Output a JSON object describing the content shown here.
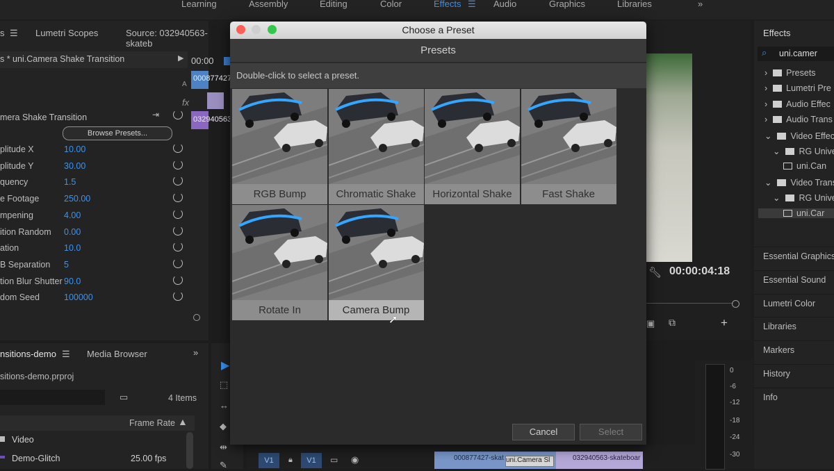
{
  "workspaces": [
    {
      "label": "Learning",
      "active": false
    },
    {
      "label": "Assembly",
      "active": false
    },
    {
      "label": "Editing",
      "active": false
    },
    {
      "label": "Color",
      "active": false
    },
    {
      "label": "Effects",
      "active": true
    },
    {
      "label": "Audio",
      "active": false
    },
    {
      "label": "Graphics",
      "active": false
    },
    {
      "label": "Libraries",
      "active": false
    }
  ],
  "left_panel": {
    "tab_fragment": "s",
    "tab_lumetri": "Lumetri Scopes",
    "tab_source": "Source: 032940563-skateb",
    "clip_title": "s * uni.Camera Shake Transition",
    "timecode": "00:00",
    "clip_a": "000877427",
    "clip_b": "032940563",
    "track_a": "A",
    "effect_name": "mera Shake Transition",
    "browse_presets": "Browse Presets...",
    "fx": "fx",
    "params": [
      {
        "label": "plitude X",
        "value": "10.00"
      },
      {
        "label": "plitude Y",
        "value": "30.00"
      },
      {
        "label": "quency",
        "value": "1.5"
      },
      {
        "label": "e Footage",
        "value": "250.00"
      },
      {
        "label": "mpening",
        "value": "4.00"
      },
      {
        "label": "ition Random",
        "value": "0.00"
      },
      {
        "label": "ation",
        "value": "10.0"
      },
      {
        "label": "B Separation",
        "value": "5"
      },
      {
        "label": "tion Blur Shutter",
        "value": "90.0"
      },
      {
        "label": "dom Seed",
        "value": "100000"
      }
    ]
  },
  "project_panel": {
    "tab": "nsitions-demo",
    "tab_media": "Media Browser",
    "file": "sitions-demo.prproj",
    "items": "4 Items",
    "col_frame_rate": "Frame Rate",
    "rows": [
      {
        "name": "Video",
        "rate": ""
      },
      {
        "name": "Demo-Glitch",
        "rate": "25.00 fps"
      }
    ]
  },
  "timeline": {
    "v1a": "V1",
    "v1b": "V1",
    "clip1": "000877427-skat",
    "clip2": "uni.Camera Sl",
    "clip3": "032940563-skateboar",
    "meter_ticks": [
      "0",
      "-6",
      "-12",
      "-18",
      "-24",
      "-30"
    ]
  },
  "program": {
    "timecode": "00:00:04:18"
  },
  "effects_panel": {
    "title": "Effects",
    "search": "uni.camer",
    "tree": [
      {
        "label": "Presets",
        "indent": 0
      },
      {
        "label": "Lumetri Pre",
        "indent": 0
      },
      {
        "label": "Audio Effec",
        "indent": 0
      },
      {
        "label": "Audio Trans",
        "indent": 0
      },
      {
        "label": "Video Effec",
        "indent": 0
      },
      {
        "label": "RG Unive",
        "indent": 1
      },
      {
        "label": "uni.Can",
        "indent": 2
      },
      {
        "label": "Video Trans",
        "indent": 0
      },
      {
        "label": "RG Unive",
        "indent": 1
      },
      {
        "label": "uni.Car",
        "indent": 2
      }
    ],
    "menu": [
      "Essential Graphics",
      "Essential Sound",
      "Lumetri Color",
      "Libraries",
      "Markers",
      "History",
      "Info"
    ]
  },
  "dialog": {
    "title": "Choose a Preset",
    "header": "Presets",
    "hint": "Double-click to select a preset.",
    "presets": [
      {
        "label": "RGB Bump",
        "selected": false
      },
      {
        "label": "Chromatic Shake",
        "selected": false
      },
      {
        "label": "Horizontal Shake",
        "selected": false
      },
      {
        "label": "Fast Shake",
        "selected": false
      },
      {
        "label": "Rotate In",
        "selected": false
      },
      {
        "label": "Camera Bump",
        "selected": true
      }
    ],
    "cancel": "Cancel",
    "select": "Select"
  },
  "colors": {
    "accent": "#3a93f0",
    "close": "#fc5f57",
    "minimize": "#d0d0d0",
    "maximize": "#34c84a"
  }
}
